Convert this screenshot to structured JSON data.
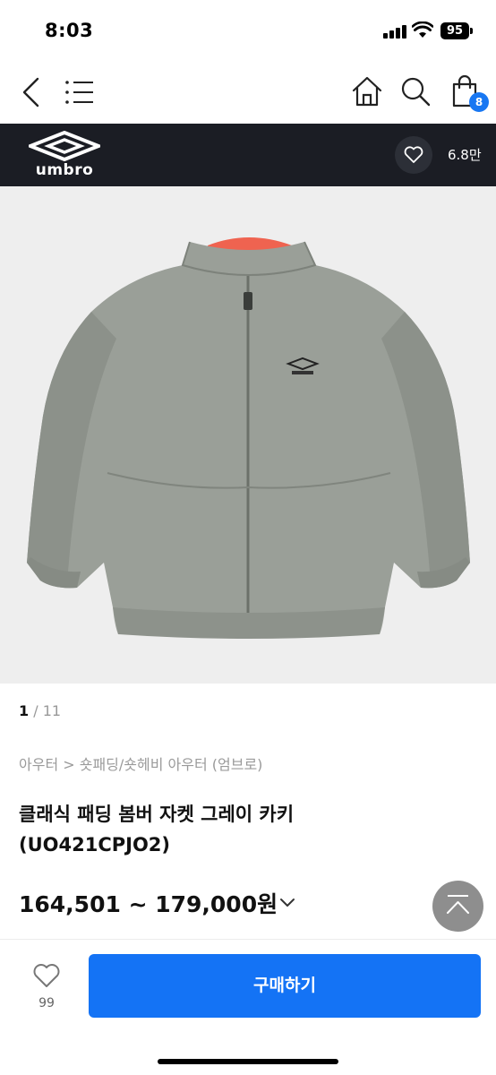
{
  "status": {
    "time": "8:03",
    "battery": "95"
  },
  "nav": {
    "icons": [
      "back-icon",
      "menu-icon",
      "home-icon",
      "search-icon",
      "cart-icon"
    ],
    "cart_count": "8"
  },
  "brand": {
    "logo_text": "umbro",
    "like_count": "6.8만"
  },
  "colors": {
    "brand_bar": "#1b1d24",
    "buy_button": "#1473f5",
    "cart_badge": "#1877f2",
    "jacket": "#9a9f98",
    "jacket_lining": "#ef6350"
  },
  "gallery": {
    "current": "1",
    "separator": "/",
    "total": "11"
  },
  "product": {
    "breadcrumb": "아우터 > 숏패딩/숏헤비 아우터 (엄브로)",
    "title": "클래식 패딩 봄버 자켓 그레이 카키 (UO421CPJO2)",
    "price": "164,501 ~ 179,000원"
  },
  "bottom": {
    "wish_count": "99",
    "buy_label": "구매하기"
  }
}
